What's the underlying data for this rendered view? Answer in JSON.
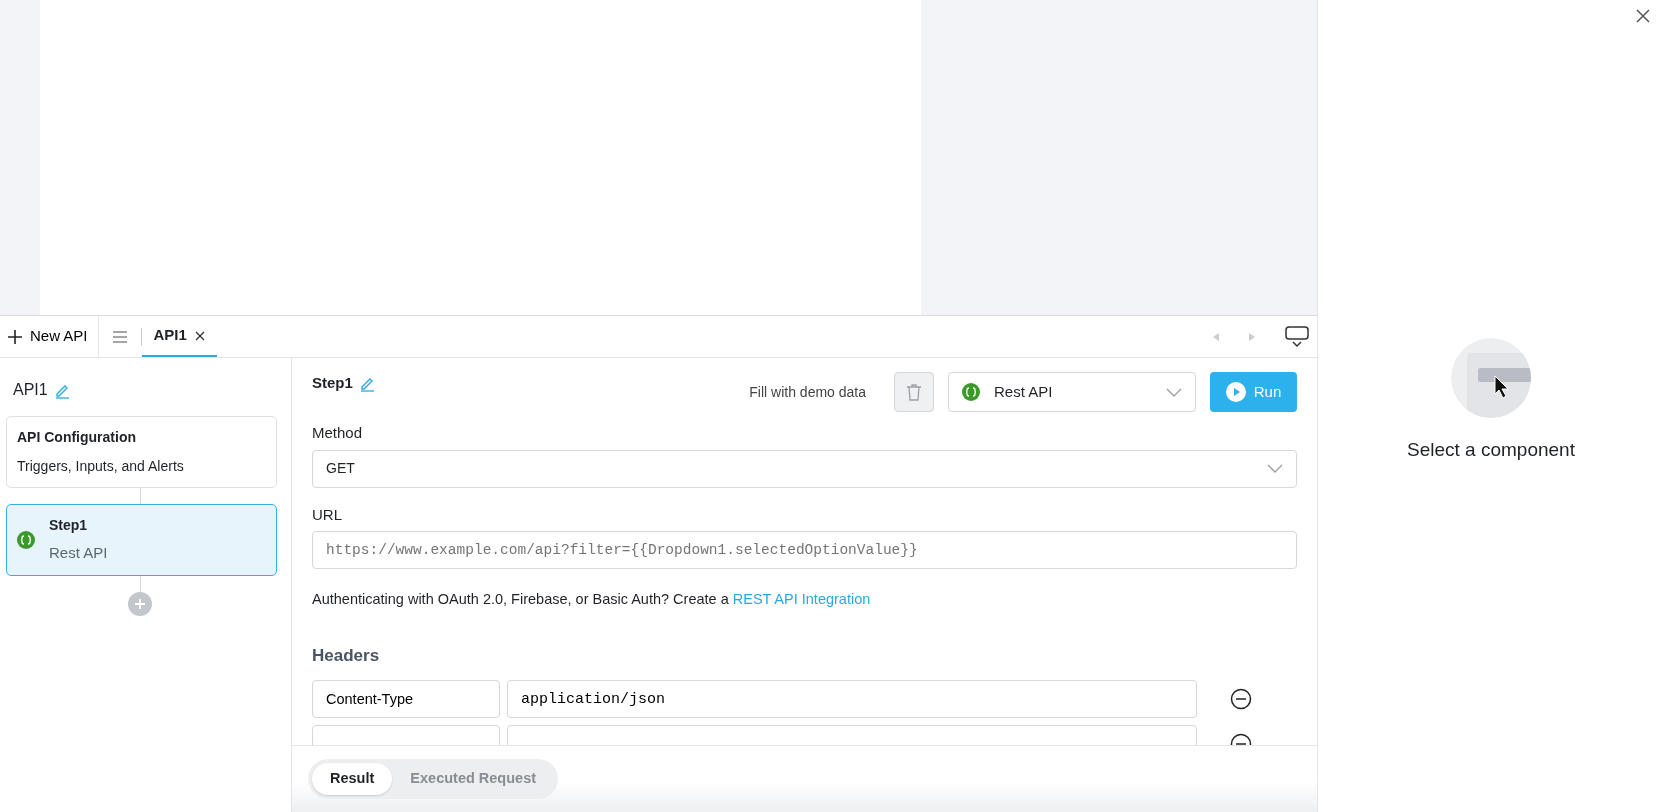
{
  "editor_bar": {
    "new_button": "New API",
    "tabs": [
      {
        "label": "API1",
        "selected": true
      }
    ]
  },
  "sidebar": {
    "title": "API1",
    "items": [
      {
        "kind": "config",
        "title": "API Configuration",
        "subtitle": "Triggers, Inputs, and Alerts",
        "selected": false
      },
      {
        "kind": "step",
        "title": "Step1",
        "subtitle": "Rest API",
        "selected": true
      }
    ]
  },
  "step": {
    "title": "Step1",
    "demo_link": "Fill with demo data",
    "resource": "Rest API",
    "run": "Run",
    "method_label": "Method",
    "method": "GET",
    "url_label": "URL",
    "url_placeholder": "https://www.example.com/api?filter={{Dropdown1.selectedOptionValue}}",
    "auth_text": "Authenticating with OAuth 2.0, Firebase, or Basic Auth? Create a ",
    "auth_link": "REST API Integration",
    "headers_title": "Headers",
    "headers": [
      {
        "key": "Content-Type",
        "value": "application/json"
      }
    ]
  },
  "result_tabs": [
    {
      "label": "Result",
      "selected": true
    },
    {
      "label": "Executed Request",
      "selected": false
    }
  ],
  "inspector": {
    "message": "Select a component"
  }
}
